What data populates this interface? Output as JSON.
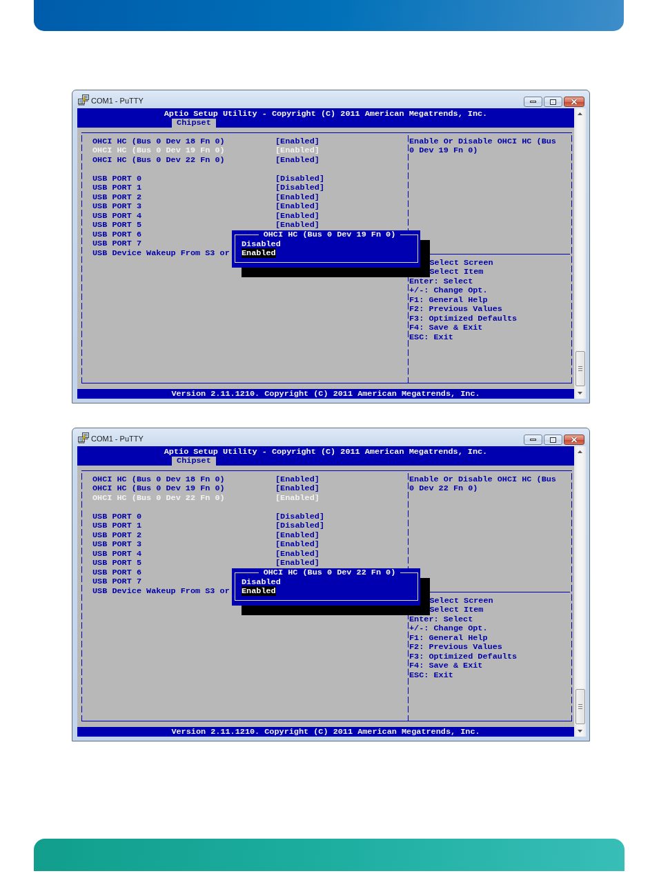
{
  "windows": [
    {
      "title": "COM1 - PuTTY",
      "header": {
        "title": "Aptio Setup Utility - Copyright (C) 2011 American Megatrends, Inc.",
        "tabs": [
          {
            "label": "Chipset",
            "selected": true
          }
        ]
      },
      "settings_groups": [
        {
          "items": [
            {
              "label": "OHCI HC (Bus 0 Dev 18 Fn 0)",
              "value": "[Enabled]",
              "selected": false
            },
            {
              "label": "OHCI HC (Bus 0 Dev 19 Fn 0)",
              "value": "[Enabled]",
              "selected": true
            },
            {
              "label": "OHCI HC (Bus 0 Dev 22 Fn 0)",
              "value": "[Enabled]",
              "selected": false
            }
          ]
        },
        {
          "items": [
            {
              "label": "USB PORT 0",
              "value": "[Disabled]",
              "selected": false
            },
            {
              "label": "USB PORT 1",
              "value": "[Disabled]",
              "selected": false
            },
            {
              "label": "USB PORT 2",
              "value": "[Enabled]",
              "selected": false
            },
            {
              "label": "USB PORT 3",
              "value": "[Enabled]",
              "selected": false
            },
            {
              "label": "USB PORT 4",
              "value": "[Enabled]",
              "selected": false
            },
            {
              "label": "USB PORT 5",
              "value": "[Enabled]",
              "selected": false
            },
            {
              "label": "USB PORT 6",
              "selected": false
            },
            {
              "label": "USB PORT 7",
              "selected": false
            },
            {
              "label": "USB Device Wakeup From S3 or",
              "selected": false
            }
          ]
        }
      ],
      "help": {
        "description": "Enable Or Disable OHCI HC (Bus 0 Dev 19 Fn 0)",
        "hints": [
          {
            "text": "Select Screen",
            "covered": true
          },
          {
            "text": "Select Item",
            "covered": true
          },
          {
            "text": "Enter: Select",
            "covered": false
          },
          {
            "text": "+/-: Change Opt.",
            "covered": false
          },
          {
            "text": "F1: General Help",
            "covered": false
          },
          {
            "text": "F2: Previous Values",
            "covered": false
          },
          {
            "text": "F3: Optimized Defaults",
            "covered": false
          },
          {
            "text": "F4: Save & Exit",
            "covered": false
          },
          {
            "text": "ESC: Exit",
            "covered": false
          }
        ]
      },
      "popup": {
        "title": "OHCI HC (Bus 0 Dev 19 Fn 0)",
        "options": [
          {
            "label": "Disabled",
            "selected": false
          },
          {
            "label": "Enabled",
            "selected": true
          }
        ]
      },
      "status_bar": "Version 2.11.1210. Copyright (C) 2011 American Megatrends, Inc."
    },
    {
      "title": "COM1 - PuTTY",
      "header": {
        "title": "Aptio Setup Utility - Copyright (C) 2011 American Megatrends, Inc.",
        "tabs": [
          {
            "label": "Chipset",
            "selected": true
          }
        ]
      },
      "settings_groups": [
        {
          "items": [
            {
              "label": "OHCI HC (Bus 0 Dev 18 Fn 0)",
              "value": "[Enabled]",
              "selected": false
            },
            {
              "label": "OHCI HC (Bus 0 Dev 19 Fn 0)",
              "value": "[Enabled]",
              "selected": false
            },
            {
              "label": "OHCI HC (Bus 0 Dev 22 Fn 0)",
              "value": "[Enabled]",
              "selected": true
            }
          ]
        },
        {
          "items": [
            {
              "label": "USB PORT 0",
              "value": "[Disabled]",
              "selected": false
            },
            {
              "label": "USB PORT 1",
              "value": "[Disabled]",
              "selected": false
            },
            {
              "label": "USB PORT 2",
              "value": "[Enabled]",
              "selected": false
            },
            {
              "label": "USB PORT 3",
              "value": "[Enabled]",
              "selected": false
            },
            {
              "label": "USB PORT 4",
              "value": "[Enabled]",
              "selected": false
            },
            {
              "label": "USB PORT 5",
              "value": "[Enabled]",
              "selected": false
            },
            {
              "label": "USB PORT 6",
              "selected": false
            },
            {
              "label": "USB PORT 7",
              "selected": false
            },
            {
              "label": "USB Device Wakeup From S3 or",
              "selected": false
            }
          ]
        }
      ],
      "help": {
        "description": "Enable Or Disable OHCI HC (Bus 0 Dev 22 Fn 0)",
        "hints": [
          {
            "text": "Select Screen",
            "covered": true
          },
          {
            "text": "Select Item",
            "covered": true
          },
          {
            "text": "Enter: Select",
            "covered": false
          },
          {
            "text": "+/-: Change Opt.",
            "covered": false
          },
          {
            "text": "F1: General Help",
            "covered": false
          },
          {
            "text": "F2: Previous Values",
            "covered": false
          },
          {
            "text": "F3: Optimized Defaults",
            "covered": false
          },
          {
            "text": "F4: Save & Exit",
            "covered": false
          },
          {
            "text": "ESC: Exit",
            "covered": false
          }
        ]
      },
      "popup": {
        "title": "OHCI HC (Bus 0 Dev 22 Fn 0)",
        "options": [
          {
            "label": "Disabled",
            "selected": false
          },
          {
            "label": "Enabled",
            "selected": true
          }
        ]
      },
      "status_bar": "Version 2.11.1210. Copyright (C) 2011 American Megatrends, Inc."
    }
  ]
}
